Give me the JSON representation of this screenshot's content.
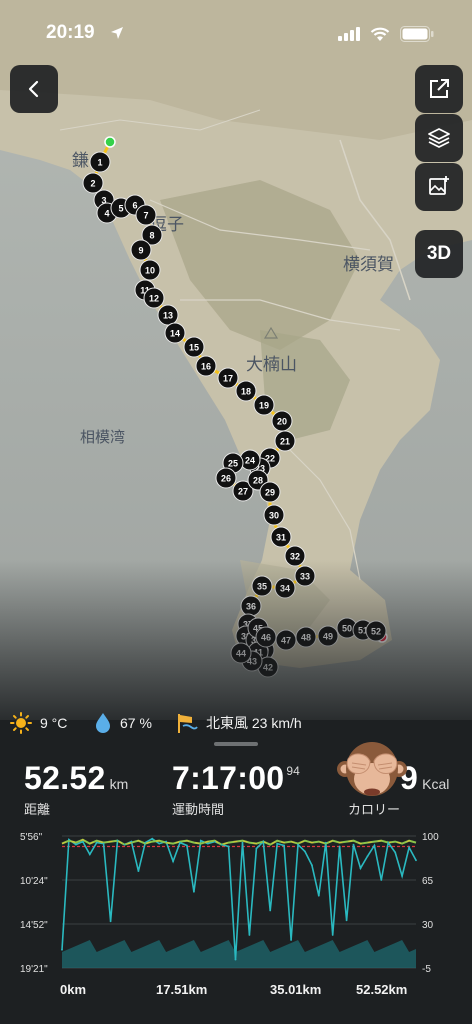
{
  "status_bar": {
    "time": "20:19"
  },
  "map": {
    "places": [
      {
        "name": "鎌",
        "id": "kamakura"
      },
      {
        "name": "逗子",
        "id": "zushi"
      },
      {
        "name": "横須賀",
        "id": "yokosuka"
      },
      {
        "name": "大楠山",
        "id": "ogusuyama"
      },
      {
        "name": "相模湾",
        "id": "sagami-bay"
      }
    ],
    "button_3d": "3D",
    "km_markers": [
      "1",
      "2",
      "3",
      "4",
      "5",
      "6",
      "7",
      "8",
      "9",
      "10",
      "11",
      "12",
      "13",
      "14",
      "15",
      "16",
      "17",
      "18",
      "19",
      "20",
      "21",
      "22",
      "23",
      "24",
      "25",
      "26",
      "27",
      "28",
      "29",
      "30",
      "31",
      "32",
      "33",
      "34",
      "35",
      "36",
      "37",
      "38",
      "39",
      "40",
      "41",
      "42",
      "43",
      "44",
      "45",
      "46",
      "47",
      "48",
      "49",
      "50",
      "51",
      "52"
    ]
  },
  "weather": {
    "temperature": "9 °C",
    "humidity": "67 %",
    "wind": "北東風 23 km/h"
  },
  "stats": {
    "distance_value": "52.52",
    "distance_unit": "km",
    "distance_label": "距離",
    "time_value": "7:17:00",
    "time_fraction": "94",
    "time_label": "運動時間",
    "calories_value": "9",
    "calories_unit": "Kcal",
    "calories_label": "カロリー"
  },
  "chart_data": {
    "type": "line",
    "y_left_ticks": [
      "5'56\"",
      "10'24\"",
      "14'52\"",
      "19'21\""
    ],
    "y_right_ticks": [
      "100",
      "65",
      "30",
      "-5"
    ],
    "x_ticks": [
      "0km",
      "17.51km",
      "35.01km",
      "52.52km"
    ],
    "x_range": [
      0,
      52.52
    ],
    "colors": {
      "pace": "#2ab9c0",
      "cadence": "#8bc34a",
      "average": "#d9363e"
    },
    "series": [
      {
        "values": [
          17.5,
          6.3,
          6.8,
          6.5,
          7.8,
          6.6,
          6.7,
          14.6,
          6.4,
          6.8,
          6.5,
          9.5,
          6.6,
          6.2,
          6.7,
          6.5,
          8.5,
          6.6,
          6.9,
          11.6,
          6.4,
          6.7,
          6.5,
          6.8,
          7.0,
          18.5,
          6.6,
          16.0,
          7.2,
          6.5,
          13.5,
          6.7,
          6.9,
          16.5,
          6.8,
          7.5,
          8.9,
          12.0,
          6.6,
          16.0,
          7.0,
          14.5,
          6.8,
          9.2,
          8.0,
          6.9,
          10.4,
          6.6,
          7.6,
          10.0,
          7.1,
          8.4
        ]
      },
      {
        "values": [
          6.5,
          6.2,
          6.4,
          6.1,
          6.5,
          6.2,
          6.4,
          6.3,
          6.2,
          6.6,
          6.4,
          6.2,
          6.5,
          6.3,
          6.2,
          6.4,
          6.5,
          6.3,
          6.2,
          6.4,
          6.5,
          6.3,
          6.2,
          6.6,
          6.4,
          6.3,
          6.2,
          6.4,
          6.5,
          6.3,
          6.6,
          6.2,
          6.4,
          6.3,
          6.5,
          6.2,
          6.4,
          6.3,
          6.5,
          6.2,
          6.4,
          6.3,
          6.2,
          6.5,
          6.4,
          6.3,
          6.2,
          6.4,
          6.3,
          6.5,
          6.2,
          6.4
        ]
      }
    ],
    "average_value": 7.0
  }
}
